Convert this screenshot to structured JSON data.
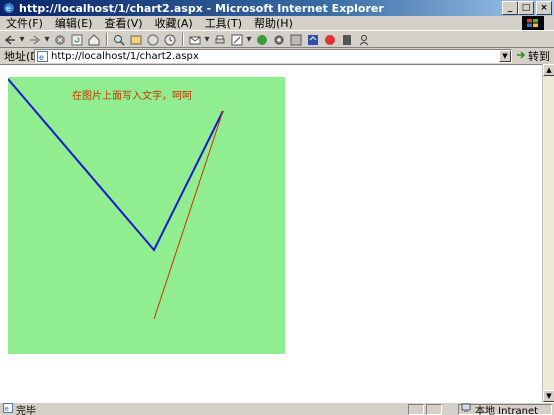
{
  "window": {
    "title": "http://localhost/1/chart2.aspx - Microsoft Internet Explorer",
    "controls": {
      "minimize": "_",
      "maximize": "□",
      "close": "×"
    }
  },
  "menu": {
    "items": [
      {
        "label": "文件(F)"
      },
      {
        "label": "编辑(E)"
      },
      {
        "label": "查看(V)"
      },
      {
        "label": "收藏(A)"
      },
      {
        "label": "工具(T)"
      },
      {
        "label": "帮助(H)"
      }
    ]
  },
  "toolbar": {
    "icons": [
      "back-icon",
      "forward-icon",
      "stop-icon",
      "refresh-icon",
      "home-icon",
      "search-icon",
      "favorites-icon",
      "media-icon",
      "history-icon",
      "mail-icon",
      "print-icon",
      "edit-icon",
      "discuss-icon",
      "messenger-icon",
      "research-icon"
    ]
  },
  "address": {
    "label": "地址(D)",
    "url": "http://localhost/1/chart2.aspx",
    "go_label": "转到"
  },
  "page": {
    "background_color": "#90ee90",
    "annotation": "在图片上面写入文字，呵呵",
    "annotation_color": "#cc3300",
    "blue_line_color": "#1a1acc",
    "red_line_color": "#cc3300"
  },
  "status": {
    "text": "完毕",
    "zone": "本地 Intranet"
  }
}
